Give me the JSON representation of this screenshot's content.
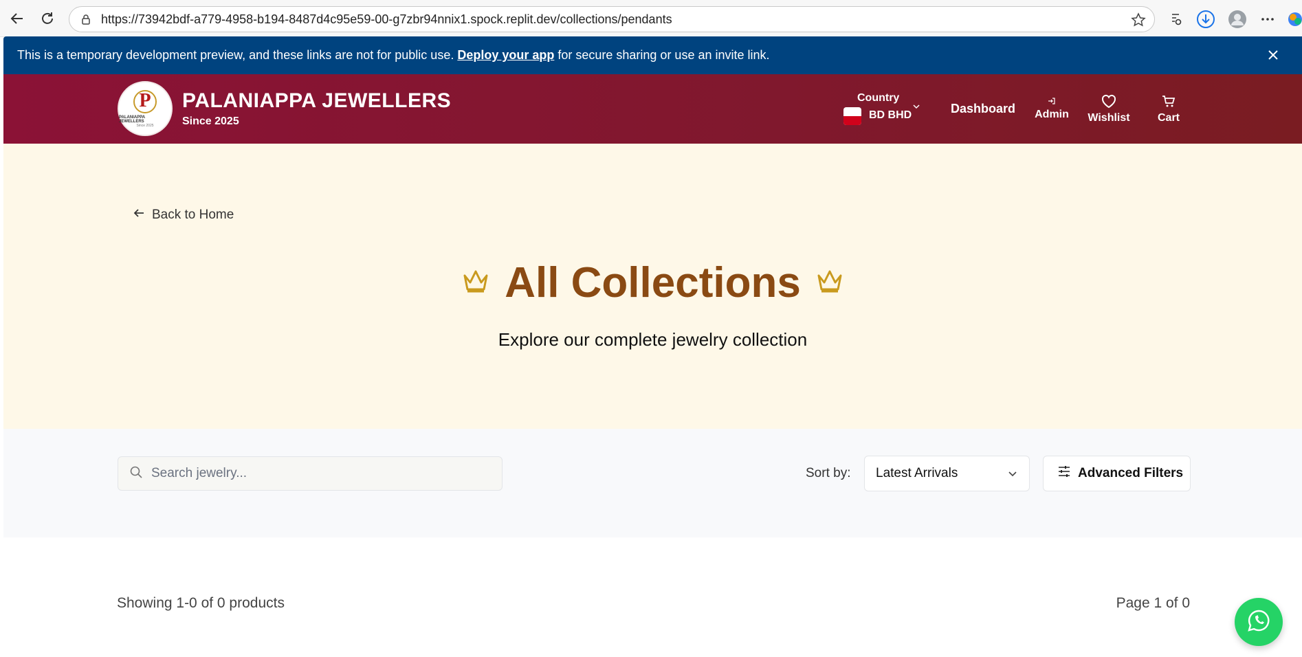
{
  "browser": {
    "url": "https://73942bdf-a779-4958-b194-8487d4c95e59-00-g7zbr94nnix1.spock.replit.dev/collections/pendants"
  },
  "dev_banner": {
    "text_before": "This is a temporary development preview, and these links are not for public use.",
    "link_text": "Deploy your app",
    "text_after": "for secure sharing or use an invite link."
  },
  "header": {
    "logo_letter": "P",
    "logo_text": "PALANIAPPA JEWELLERS",
    "logo_since": "Since 2025",
    "brand_name": "PALANIAPPA JEWELLERS",
    "brand_sub": "Since 2025",
    "country_label": "Country",
    "country_value": "BD BHD",
    "nav": {
      "dashboard": "Dashboard",
      "admin": "Admin",
      "wishlist": "Wishlist",
      "cart": "Cart"
    }
  },
  "hero": {
    "back_label": "Back to Home",
    "title": "All Collections",
    "subtitle": "Explore our complete jewelry collection"
  },
  "filters": {
    "search_placeholder": "Search jewelry...",
    "sort_label": "Sort by:",
    "sort_value": "Latest Arrivals",
    "advanced_label": "Advanced Filters"
  },
  "results": {
    "showing": "Showing 1-0 of 0 products",
    "page": "Page 1 of 0"
  },
  "colors": {
    "banner": "#00437f",
    "header": "#8b1236",
    "hero_bg": "#fef8e8",
    "title": "#8a4a13",
    "crown": "#c99a1e",
    "whatsapp": "#25d366"
  }
}
